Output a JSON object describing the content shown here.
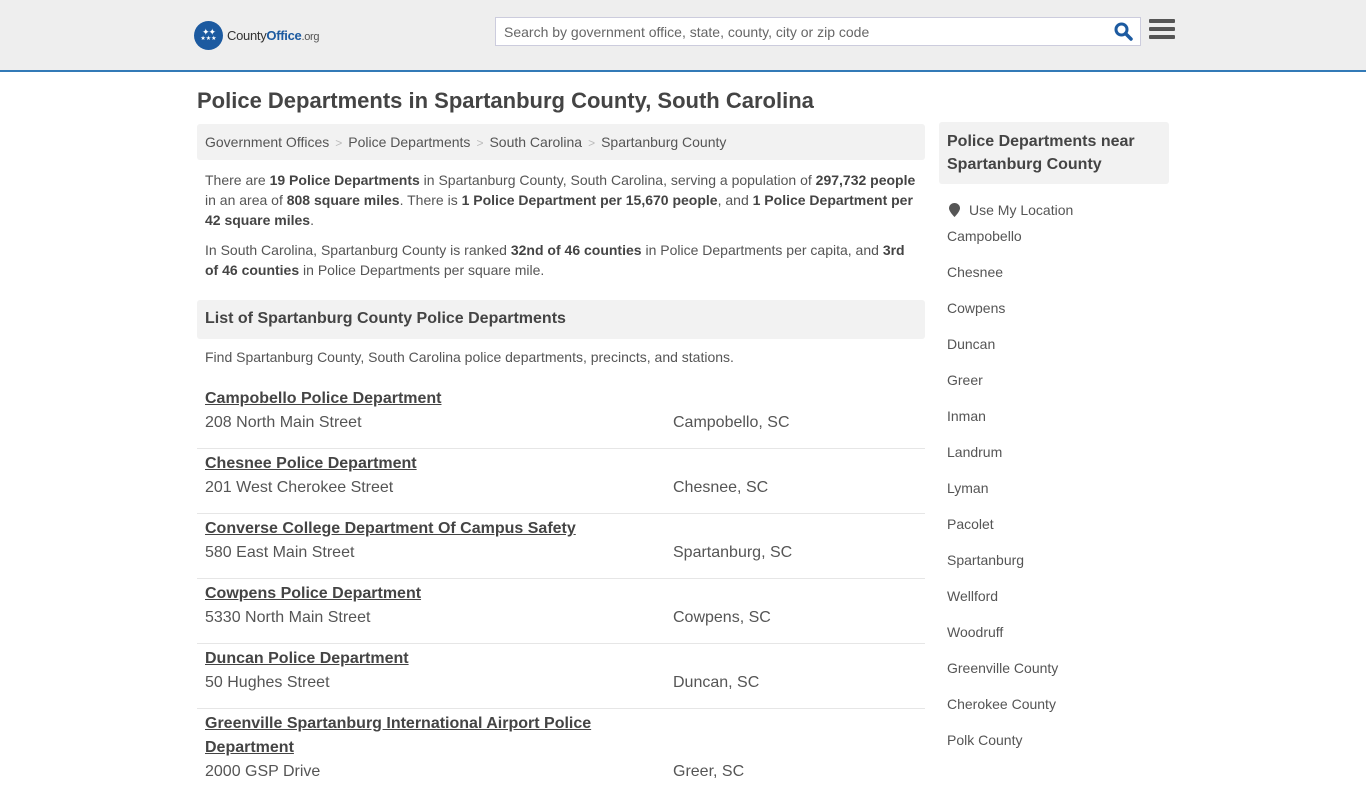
{
  "header": {
    "logo_brand": "County",
    "logo_brand_bold": "Office",
    "logo_tld": ".org",
    "search_placeholder": "Search by government office, state, county, city or zip code",
    "search_value": "",
    "search_icon": "search-icon",
    "menu_icon": "hamburger-menu-icon",
    "accent_color": "#337ab7",
    "brand_color": "#1c5aa0"
  },
  "page": {
    "title": "Police Departments in Spartanburg County, South Carolina"
  },
  "breadcrumb": [
    {
      "label": "Government Offices"
    },
    {
      "label": "Police Departments"
    },
    {
      "label": "South Carolina"
    },
    {
      "label": "Spartanburg County"
    }
  ],
  "intro": {
    "p1": {
      "t1": "There are ",
      "b1": "19 Police Departments",
      "t2": " in Spartanburg County, South Carolina, serving a population of ",
      "b2": "297,732 people",
      "t3": " in an area of ",
      "b3": "808 square miles",
      "t4": ". There is ",
      "b4": "1 Police Department per 15,670 people",
      "t5": ", and ",
      "b5": "1 Police Department per 42 square miles",
      "t6": "."
    },
    "p2": {
      "t1": "In South Carolina, Spartanburg County is ranked ",
      "b1": "32nd of 46 counties",
      "t2": " in Police Departments per capita, and ",
      "b2": "3rd of 46 counties",
      "t3": " in Police Departments per square mile."
    }
  },
  "list": {
    "heading": "List of Spartanburg County Police Departments",
    "description": "Find Spartanburg County, South Carolina police departments, precincts, and stations.",
    "items": [
      {
        "name": "Campobello Police Department",
        "address": "208 North Main Street",
        "city": "Campobello, SC"
      },
      {
        "name": "Chesnee Police Department",
        "address": "201 West Cherokee Street",
        "city": "Chesnee, SC"
      },
      {
        "name": "Converse College Department Of Campus Safety",
        "address": "580 East Main Street",
        "city": "Spartanburg, SC"
      },
      {
        "name": "Cowpens Police Department",
        "address": "5330 North Main Street",
        "city": "Cowpens, SC"
      },
      {
        "name": "Duncan Police Department",
        "address": "50 Hughes Street",
        "city": "Duncan, SC"
      },
      {
        "name": "Greenville Spartanburg International Airport Police Department",
        "address": "2000 GSP Drive",
        "city": "Greer, SC"
      }
    ]
  },
  "sidebar": {
    "heading": "Police Departments near Spartanburg County",
    "use_location": "Use My Location",
    "links": [
      "Campobello",
      "Chesnee",
      "Cowpens",
      "Duncan",
      "Greer",
      "Inman",
      "Landrum",
      "Lyman",
      "Pacolet",
      "Spartanburg",
      "Wellford",
      "Woodruff",
      "Greenville County",
      "Cherokee County",
      "Polk County"
    ]
  }
}
